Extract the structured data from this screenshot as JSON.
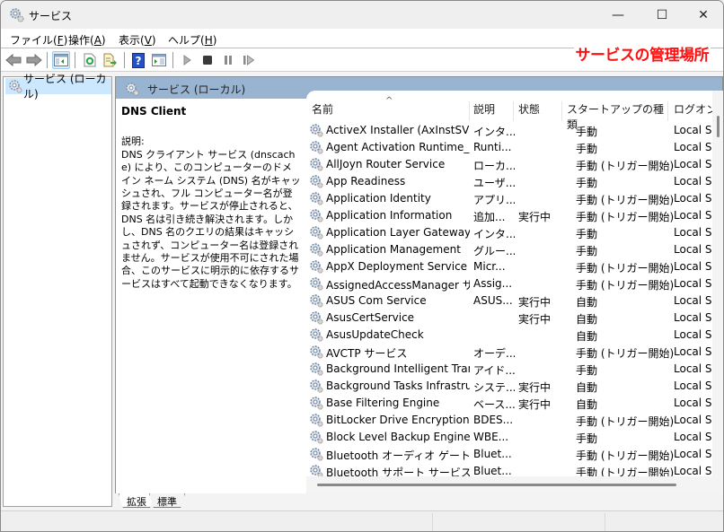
{
  "window": {
    "title": "サービス",
    "minimize_label": "—",
    "maximize_label": "☐",
    "close_label": "✕"
  },
  "menu": [
    {
      "label": "ファイル(",
      "key": "F",
      "end": ")"
    },
    {
      "label": "操作(",
      "key": "A",
      "end": ")"
    },
    {
      "label": "表示(",
      "key": "V",
      "end": ")"
    },
    {
      "label": "ヘルプ(",
      "key": "H",
      "end": ")"
    }
  ],
  "toolbar": {
    "icons": [
      "back-icon",
      "forward-icon",
      "show-hide-console-tree-icon",
      "refresh-icon",
      "export-list-icon",
      "help-icon",
      "properties-icon",
      "start-service-icon",
      "stop-service-icon",
      "pause-service-icon",
      "resume-service-icon"
    ]
  },
  "annotation": "サービスの管理場所",
  "tree": {
    "items": [
      {
        "label": "サービス (ローカル)"
      }
    ]
  },
  "pane": {
    "header": "サービス (ローカル)",
    "selected_service": "DNS Client",
    "description_label": "説明:",
    "description": "DNS クライアント サービス (dnscache) により、このコンピューターのドメイン ネーム システム (DNS) 名がキャッシュされ、フル コンピューター名が登録されます。サービスが停止されると、DNS 名は引き続き解決されます。しかし、DNS 名のクエリの結果はキャッシュされず、コンピューター名は登録されません。サービスが使用不可にされた場合、このサービスに明示的に依存するサービスはすべて起動できなくなります。"
  },
  "columns": {
    "name": "名前",
    "description": "説明",
    "status": "状態",
    "startup": "スタートアップの種類",
    "logon": "ログオン",
    "sort_indicator": "^"
  },
  "services": [
    {
      "name": "ActiveX Installer (AxInstSV)",
      "desc": "インタ...",
      "status": "",
      "startup": "手動",
      "logon": "Local S"
    },
    {
      "name": "Agent Activation Runtime_e...",
      "desc": "Runti...",
      "status": "",
      "startup": "手動",
      "logon": "Local S"
    },
    {
      "name": "AllJoyn Router Service",
      "desc": "ローカ...",
      "status": "",
      "startup": "手動 (トリガー開始)",
      "logon": "Local S"
    },
    {
      "name": "App Readiness",
      "desc": "ユーザ...",
      "status": "",
      "startup": "手動",
      "logon": "Local S"
    },
    {
      "name": "Application Identity",
      "desc": "アプリ...",
      "status": "",
      "startup": "手動 (トリガー開始)",
      "logon": "Local S"
    },
    {
      "name": "Application Information",
      "desc": "追加...",
      "status": "実行中",
      "startup": "手動 (トリガー開始)",
      "logon": "Local S"
    },
    {
      "name": "Application Layer Gateway ...",
      "desc": "インタ...",
      "status": "",
      "startup": "手動",
      "logon": "Local S"
    },
    {
      "name": "Application Management",
      "desc": "グルー...",
      "status": "",
      "startup": "手動",
      "logon": "Local S"
    },
    {
      "name": "AppX Deployment Service (...",
      "desc": "Micr...",
      "status": "",
      "startup": "手動 (トリガー開始)",
      "logon": "Local S"
    },
    {
      "name": "AssignedAccessManager サ...",
      "desc": "Assig...",
      "status": "",
      "startup": "手動 (トリガー開始)",
      "logon": "Local S"
    },
    {
      "name": "ASUS Com Service",
      "desc": "ASUS...",
      "status": "実行中",
      "startup": "自動",
      "logon": "Local S"
    },
    {
      "name": "AsusCertService",
      "desc": "",
      "status": "実行中",
      "startup": "自動",
      "logon": "Local S"
    },
    {
      "name": "AsusUpdateCheck",
      "desc": "",
      "status": "",
      "startup": "自動",
      "logon": "Local S"
    },
    {
      "name": "AVCTP サービス",
      "desc": "オーデ...",
      "status": "",
      "startup": "手動 (トリガー開始)",
      "logon": "Local S"
    },
    {
      "name": "Background Intelligent Tran...",
      "desc": "アイド...",
      "status": "",
      "startup": "手動",
      "logon": "Local S"
    },
    {
      "name": "Background Tasks Infrastruc...",
      "desc": "システ...",
      "status": "実行中",
      "startup": "自動",
      "logon": "Local S"
    },
    {
      "name": "Base Filtering Engine",
      "desc": "ベース...",
      "status": "実行中",
      "startup": "自動",
      "logon": "Local S"
    },
    {
      "name": "BitLocker Drive Encryption ...",
      "desc": "BDES...",
      "status": "",
      "startup": "手動 (トリガー開始)",
      "logon": "Local S"
    },
    {
      "name": "Block Level Backup Engine ...",
      "desc": "WBE...",
      "status": "",
      "startup": "手動",
      "logon": "Local S"
    },
    {
      "name": "Bluetooth オーディオ ゲートウェ...",
      "desc": "Bluet...",
      "status": "",
      "startup": "手動 (トリガー開始)",
      "logon": "Local S"
    },
    {
      "name": "Bluetooth サポート サービス",
      "desc": "Bluet...",
      "status": "",
      "startup": "手動 (トリガー開始)",
      "logon": "Local S"
    }
  ],
  "tabs": [
    {
      "label": "拡張"
    },
    {
      "label": "標準"
    }
  ],
  "colors": {
    "annotation": "#ff1010",
    "pane_header": "#99b4d1",
    "selection": "#cce8ff"
  }
}
